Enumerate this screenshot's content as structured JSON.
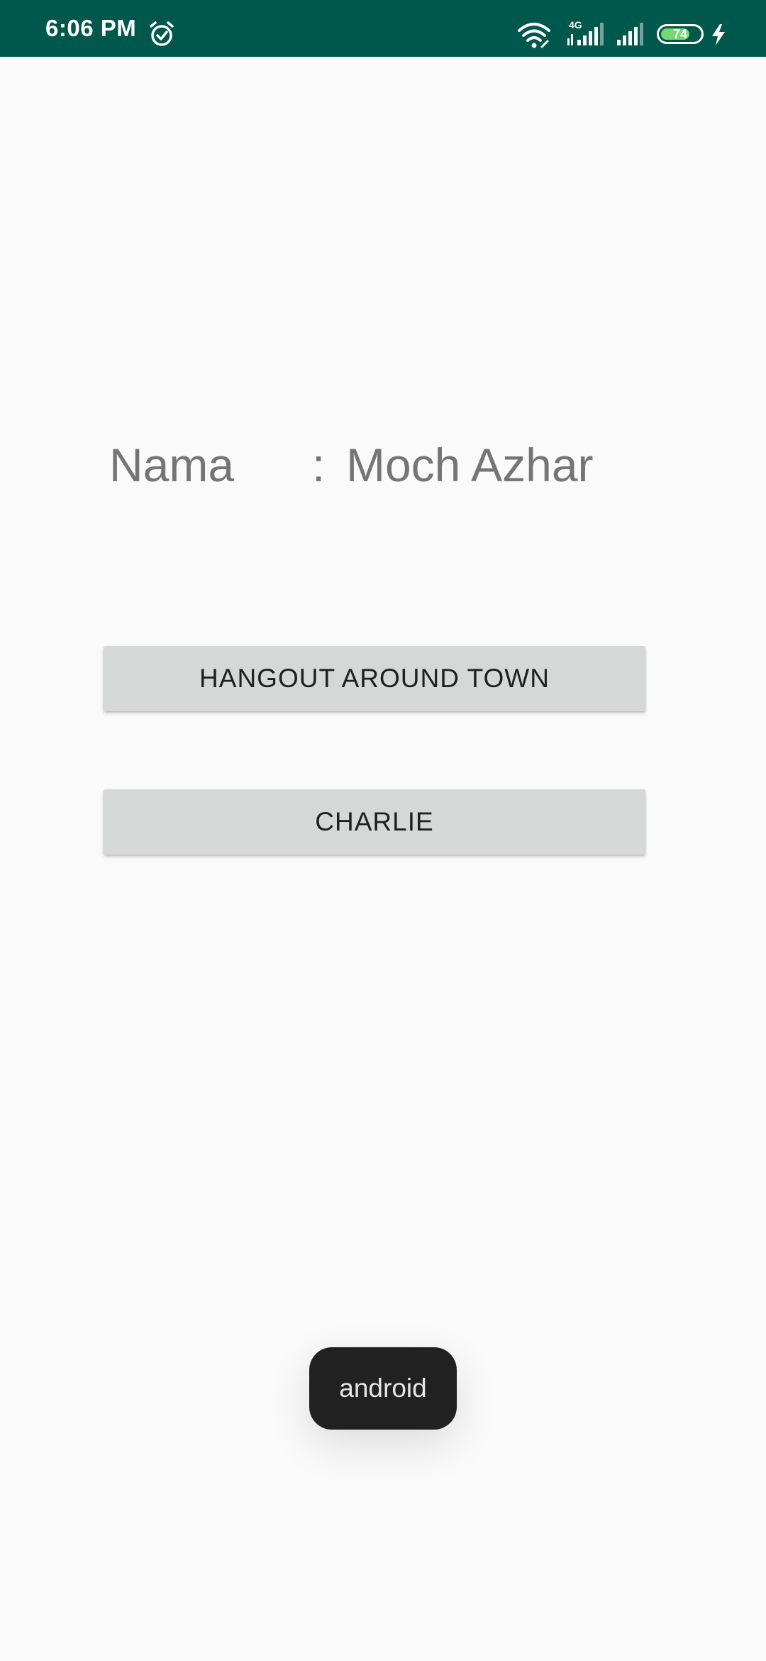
{
  "status_bar": {
    "time": "6:06 PM",
    "network_type": "4G",
    "battery_level": "74",
    "battery_fraction": 0.74,
    "background_color": "#00574b",
    "icons": [
      "alarm-icon",
      "wifi-icon",
      "cell-signal-icon",
      "cell-signal-icon",
      "battery-icon",
      "charging-icon"
    ]
  },
  "main": {
    "name_label": "Nama",
    "name_separator": ":",
    "name_value": "Moch Azhar",
    "buttons": [
      {
        "label": "HANGOUT AROUND TOWN"
      },
      {
        "label": "CHARLIE"
      }
    ]
  },
  "toast": {
    "text": "android"
  }
}
